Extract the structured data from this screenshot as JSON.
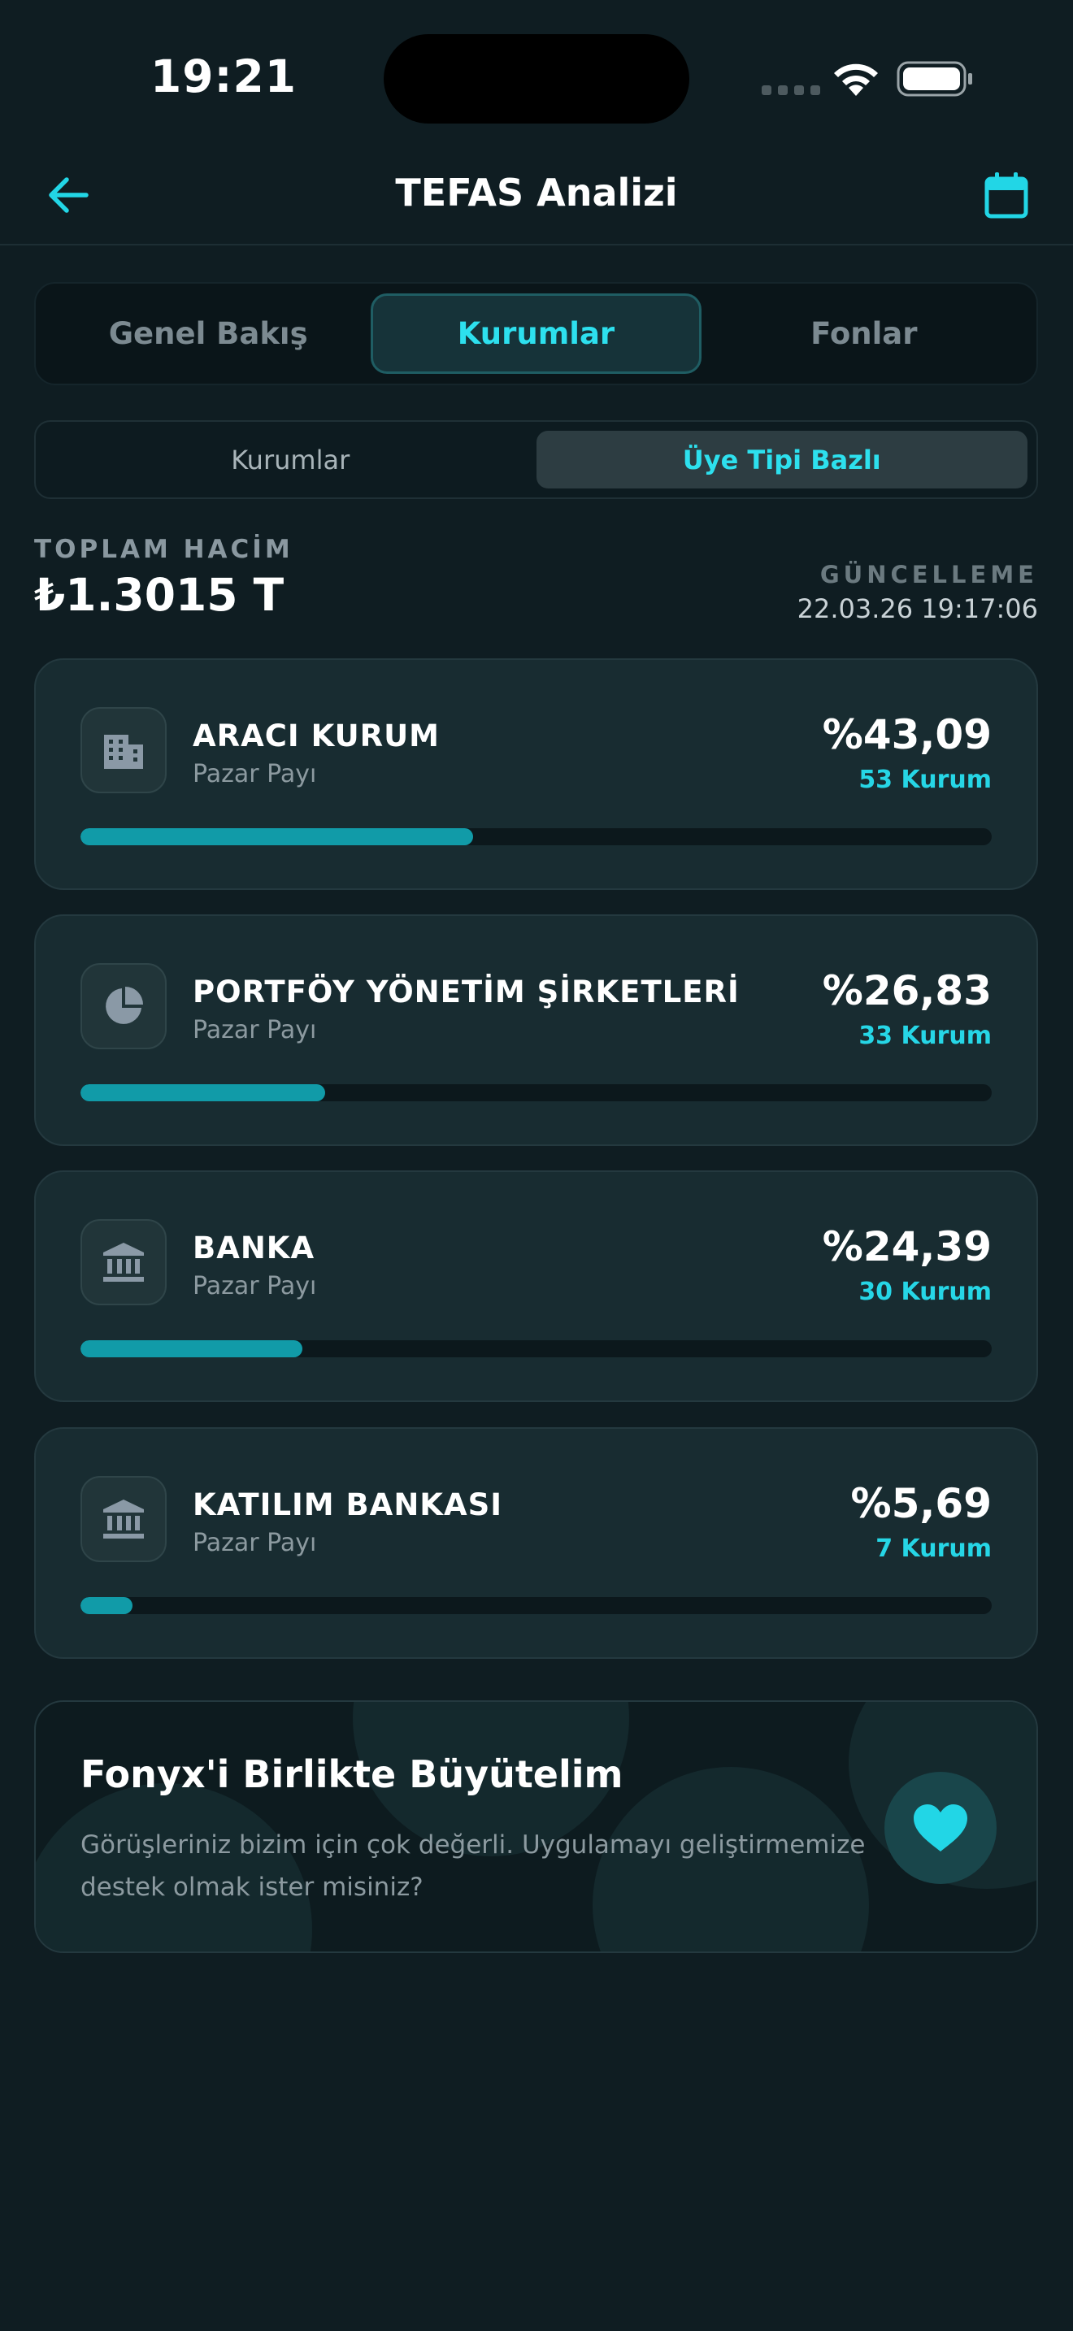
{
  "status_bar": {
    "time": "19:21"
  },
  "header": {
    "title": "TEFAS Analizi"
  },
  "main_tabs": [
    {
      "label": "Genel Bakış"
    },
    {
      "label": "Kurumlar"
    },
    {
      "label": "Fonlar"
    }
  ],
  "main_tabs_active": "Kurumlar",
  "sub_tabs": [
    {
      "label": "Kurumlar"
    },
    {
      "label": "Üye Tipi Bazlı"
    }
  ],
  "sub_tabs_active": "Üye Tipi Bazlı",
  "summary": {
    "total_label": "TOPLAM HACİM",
    "total_value": "₺1.3015 T",
    "update_label": "GÜNCELLEME",
    "update_value": "22.03.26 19:17:06"
  },
  "cards": [
    {
      "name": "ARACI KURUM",
      "subtitle": "Pazar Payı",
      "percent": "%43,09",
      "count": "53 Kurum",
      "share": 43.09,
      "icon": "building-icon"
    },
    {
      "name": "PORTFÖY YÖNETİM ŞİRKETLERİ",
      "subtitle": "Pazar Payı",
      "percent": "%26,83",
      "count": "33 Kurum",
      "share": 26.83,
      "icon": "pie-chart-icon"
    },
    {
      "name": "BANKA",
      "subtitle": "Pazar Payı",
      "percent": "%24,39",
      "count": "30 Kurum",
      "share": 24.39,
      "icon": "bank-icon"
    },
    {
      "name": "KATILIM BANKASI",
      "subtitle": "Pazar Payı",
      "percent": "%5,69",
      "count": "7 Kurum",
      "share": 5.69,
      "icon": "bank-icon"
    }
  ],
  "feedback": {
    "title": "Fonyx'i Birlikte Büyütelim",
    "text": "Görüşleriniz bizim için çok değerli. Uygulamayı geliştirmemize destek olmak ister misiniz?",
    "icon": "heart-icon"
  },
  "colors": {
    "background": "#0f1d22",
    "card": "#182c31",
    "accent": "#2de0ee",
    "bar": "#119ba8"
  }
}
